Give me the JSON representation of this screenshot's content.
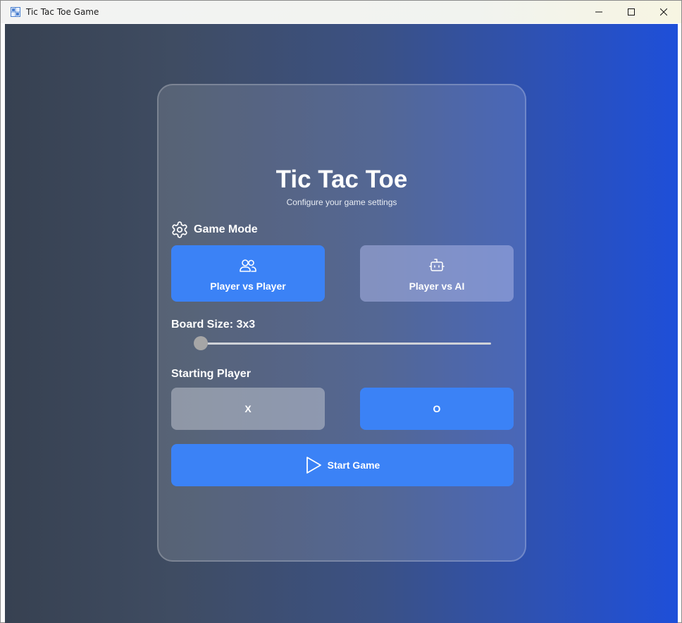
{
  "window": {
    "title": "Tic Tac Toe Game"
  },
  "header": {
    "title": "Tic Tac Toe",
    "subtitle": "Configure your game settings"
  },
  "game_mode": {
    "label": "Game Mode",
    "icon": "gear-icon",
    "options": [
      {
        "label": "Player vs Player",
        "icon": "users-icon",
        "selected": true
      },
      {
        "label": "Player vs AI",
        "icon": "robot-icon",
        "selected": false
      }
    ]
  },
  "board_size": {
    "label": "Board Size: 3x3",
    "value": 3
  },
  "starting_player": {
    "label": "Starting Player",
    "options": [
      {
        "label": "X",
        "selected": false
      },
      {
        "label": "O",
        "selected": true
      }
    ]
  },
  "start_button": {
    "label": "Start Game",
    "icon": "play-icon"
  },
  "colors": {
    "accent": "#3b82f6",
    "background_start": "#374151",
    "background_end": "#1e4fd9"
  }
}
